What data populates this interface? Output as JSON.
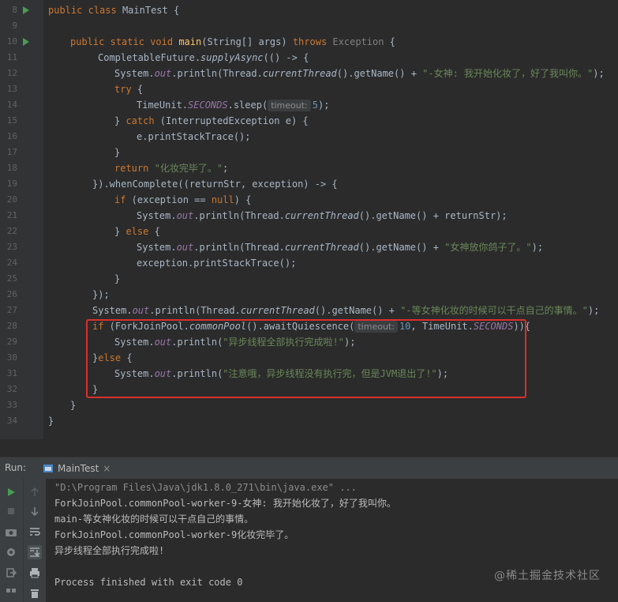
{
  "editor": {
    "line_numbers": [
      "8",
      "9",
      "10",
      "11",
      "12",
      "13",
      "14",
      "15",
      "16",
      "17",
      "18",
      "19",
      "20",
      "21",
      "22",
      "23",
      "24",
      "25",
      "26",
      "27",
      "28",
      "29",
      "30",
      "31",
      "32",
      "33",
      "34"
    ],
    "class_decl": {
      "kw1": "public",
      "kw2": "class",
      "name": "MainTest {"
    },
    "line9": {
      "kw1": "public",
      "kw2": "static",
      "kw3": "void",
      "name": "main",
      "args": "(String[] args) ",
      "throws": "throws",
      "exc": "Exception",
      "brace": " {"
    },
    "line10": {
      "pre": "CompletableFuture.",
      "fn": "supplyAsync",
      "post": "(() -> {"
    },
    "line11": {
      "pre": "System.",
      "fld": "out",
      "mid": ".println(Thread.",
      "sta": "currentThread",
      "post": "().getName() + ",
      "str": "\"-女神: 我开始化妆了，好了我叫你。\"",
      "end": ");"
    },
    "line12": {
      "kw": "try",
      "post": " {"
    },
    "line13": {
      "pre": "TimeUnit.",
      "fld": "SECONDS",
      "mid": ".sleep(",
      "hint": "timeout:",
      "num": "5",
      "end": ");"
    },
    "line14": {
      "pre": "} ",
      "kw": "catch",
      "post": " (InterruptedException e) {"
    },
    "line15": {
      "text": "e.printStackTrace();"
    },
    "line16": {
      "text": "}"
    },
    "line17": {
      "kw": "return",
      "str": "\"化妆完毕了。\"",
      "end": ";"
    },
    "line18": {
      "pre": "}).whenComplete((returnStr, exception) -> {"
    },
    "line19": {
      "kw": "if",
      "mid": " (exception == ",
      "kw2": "null",
      "end": ") {"
    },
    "line20": {
      "pre": "System.",
      "fld": "out",
      "mid": ".println(Thread.",
      "sta": "currentThread",
      "post": "().getName() + returnStr);"
    },
    "line21": {
      "pre": "} ",
      "kw": "else",
      "post": " {"
    },
    "line22": {
      "pre": "System.",
      "fld": "out",
      "mid": ".println(Thread.",
      "sta": "currentThread",
      "post": "().getName() + ",
      "str": "\"女神放你鸽子了。\"",
      "end": ");"
    },
    "line23": {
      "text": "exception.printStackTrace();"
    },
    "line24": {
      "text": "}"
    },
    "line25": {
      "text": "});"
    },
    "line26": {
      "pre": "System.",
      "fld": "out",
      "mid": ".println(Thread.",
      "sta": "currentThread",
      "post": "().getName() + ",
      "str": "\"-等女神化妆的时候可以干点自己的事情。\"",
      "end": ");"
    },
    "line27": {
      "kw": "if",
      "pre": " (ForkJoinPool.",
      "sta": "commonPool",
      "mid": "().awaitQuiescence(",
      "hint": "timeout:",
      "num": "10",
      "post": ", TimeUnit.",
      "fld": "SECONDS",
      "end": ")){"
    },
    "line28": {
      "pre": "System.",
      "fld": "out",
      "mid": ".println(",
      "str": "\"异步线程全部执行完成啦!\"",
      "end": ");"
    },
    "line29": {
      "pre": "}",
      "kw": "else",
      "post": " {"
    },
    "line30": {
      "pre": "System.",
      "fld": "out",
      "mid": ".println(",
      "str": "\"注意哦，异步线程没有执行完，但是JVM退出了!\"",
      "end": ");"
    },
    "line31": {
      "text": "}"
    },
    "line32": {
      "text": "}"
    },
    "line33": {
      "text": "}"
    }
  },
  "run_panel": {
    "label": "Run:",
    "tab_name": "MainTest",
    "close_glyph": "×",
    "console_lines": [
      "\"D:\\Program Files\\Java\\jdk1.8.0_271\\bin\\java.exe\" ...",
      "ForkJoinPool.commonPool-worker-9-女神: 我开始化妆了，好了我叫你。",
      "main-等女神化妆的时候可以干点自己的事情。",
      "ForkJoinPool.commonPool-worker-9化妆完毕了。",
      "异步线程全部执行完成啦!",
      "",
      "Process finished with exit code 0"
    ]
  },
  "watermark": "@稀土掘金技术社区",
  "colors": {
    "accent_run": "#499c54",
    "highlight_border": "#d9302c",
    "background": "#2b2b2b"
  }
}
